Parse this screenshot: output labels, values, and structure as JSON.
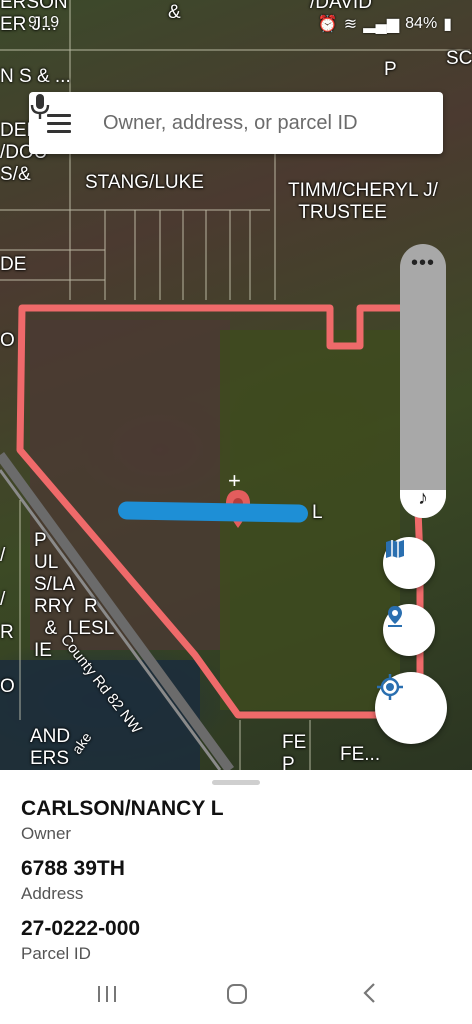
{
  "status": {
    "time": "9:19",
    "battery": "84%",
    "icons": [
      "alarm-icon",
      "location-icon",
      "wifi-icon",
      "signal-icon",
      "battery-icon"
    ]
  },
  "search": {
    "placeholder": "Owner, address, or parcel ID"
  },
  "map": {
    "labels": [
      {
        "id": "ERSON",
        "text": "ERSON\nER J..."
      },
      {
        "id": "DAVID",
        "text": "/DAVID"
      },
      {
        "id": "amp1",
        "text": "&"
      },
      {
        "id": "NS",
        "text": "N S & ..."
      },
      {
        "id": "P1",
        "text": "P"
      },
      {
        "id": "SC",
        "text": "SC"
      },
      {
        "id": "DERDOU",
        "text": "DER\n/DOU\nS/&"
      },
      {
        "id": "STANG",
        "text": "STANG/LUKE"
      },
      {
        "id": "TIMM",
        "text": "TIMM/CHERYL J/\n  TRUSTEE"
      },
      {
        "id": "DE",
        "text": "DE"
      },
      {
        "id": "O1",
        "text": "O"
      },
      {
        "id": "PAUL",
        "text": "P\nUL\nS/LA\nRRY  R\n  &  LESL\nIE"
      },
      {
        "id": "slash",
        "text": "/\n\n/"
      },
      {
        "id": "R",
        "text": "R"
      },
      {
        "id": "O2",
        "text": "O"
      },
      {
        "id": "AND",
        "text": "AND\nERS"
      },
      {
        "id": "FE1",
        "text": "FE\nP"
      },
      {
        "id": "FE2",
        "text": "FE..."
      },
      {
        "id": "L",
        "text": "L"
      }
    ],
    "road_label": "County Rd 82 NW",
    "lake_label": "ake"
  },
  "details": {
    "owner": "CARLSON/NANCY L",
    "owner_label": "Owner",
    "address": "6788 39TH",
    "address_label": "Address",
    "parcel_id": "27-0222-000",
    "parcel_label": "Parcel ID"
  },
  "colors": {
    "parcel_outline": "#ef6a6a",
    "pin": "#e35d5d",
    "accent": "#2a6fb0"
  }
}
